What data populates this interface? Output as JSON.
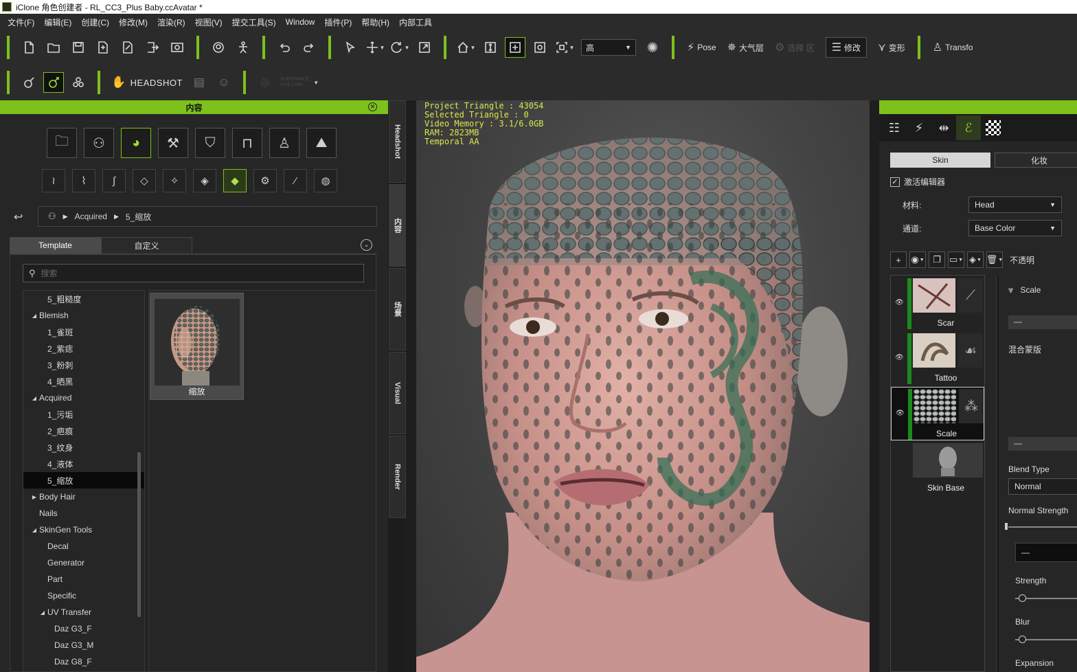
{
  "window": {
    "title": "iClone 角色创建者 - RL_CC3_Plus Baby.ccAvatar *"
  },
  "menu": [
    "文件(F)",
    "编辑(E)",
    "创建(C)",
    "修改(M)",
    "渲染(R)",
    "视图(V)",
    "提交工具(S)",
    "Window",
    "插件(P)",
    "帮助(H)",
    "内部工具"
  ],
  "toolbar": {
    "quality_value": "高",
    "pose_label": "Pose",
    "atmosphere_label": "大气层",
    "inactive_label": "选择 区",
    "modify_label": "修改",
    "deform_label": "变形",
    "transform_label": "Transfo"
  },
  "toolbar2": {
    "headshot_label": "HEADSHOT",
    "disabled_label_1": "SUBSTANCE",
    "disabled_label_2": "LIVE LINK"
  },
  "left_panel": {
    "title": "内容",
    "breadcrumb": [
      "Acquired",
      "5_缩放"
    ],
    "tabs": [
      "Template",
      "自定义"
    ],
    "search_placeholder": "搜索",
    "tree": [
      {
        "label": "5_粗糙度",
        "indent": 2,
        "arrow": ""
      },
      {
        "label": "Blemish",
        "indent": 1,
        "arrow": "down"
      },
      {
        "label": "1_雀斑",
        "indent": 2,
        "arrow": ""
      },
      {
        "label": "2_紫痣",
        "indent": 2,
        "arrow": ""
      },
      {
        "label": "3_粉刺",
        "indent": 2,
        "arrow": ""
      },
      {
        "label": "4_晒黑",
        "indent": 2,
        "arrow": ""
      },
      {
        "label": "Acquired",
        "indent": 1,
        "arrow": "down"
      },
      {
        "label": "1_污垢",
        "indent": 2,
        "arrow": ""
      },
      {
        "label": "2_疤痕",
        "indent": 2,
        "arrow": ""
      },
      {
        "label": "3_纹身",
        "indent": 2,
        "arrow": ""
      },
      {
        "label": "4_液体",
        "indent": 2,
        "arrow": ""
      },
      {
        "label": "5_缩放",
        "indent": 2,
        "arrow": "",
        "selected": true
      },
      {
        "label": "Body Hair",
        "indent": 1,
        "arrow": "right"
      },
      {
        "label": "Nails",
        "indent": 1,
        "arrow": ""
      },
      {
        "label": "SkinGen Tools",
        "indent": 1,
        "arrow": "down"
      },
      {
        "label": "Decal",
        "indent": 2,
        "arrow": ""
      },
      {
        "label": "Generator",
        "indent": 2,
        "arrow": ""
      },
      {
        "label": "Part",
        "indent": 2,
        "arrow": ""
      },
      {
        "label": "Specific",
        "indent": 2,
        "arrow": ""
      },
      {
        "label": "UV Transfer",
        "indent": 2,
        "arrow": "down"
      },
      {
        "label": "Daz G3_F",
        "indent": 3,
        "arrow": ""
      },
      {
        "label": "Daz G3_M",
        "indent": 3,
        "arrow": ""
      },
      {
        "label": "Daz G8_F",
        "indent": 3,
        "arrow": ""
      }
    ],
    "item": {
      "label": "缩放"
    }
  },
  "side_tabs": [
    "Headshot",
    "内容",
    "场景",
    "Visual",
    "Render"
  ],
  "viewport": {
    "stats": [
      "Project Triangle : 43054",
      "Selected Triangle : 0",
      "Video Memory : 3.1/6.0GB",
      "RAM: 2823MB",
      "Temporal AA"
    ]
  },
  "right_panel": {
    "segments": [
      "Skin",
      "化妆"
    ],
    "activate_label": "激活编辑器",
    "activate_checked": true,
    "material_label": "材料:",
    "material_value": "Head",
    "channel_label": "通道:",
    "channel_value": "Base Color",
    "opacity_label": "不透明",
    "layers": [
      {
        "name": "Scar",
        "selected": false
      },
      {
        "name": "Tattoo",
        "selected": false
      },
      {
        "name": "Scale",
        "selected": true
      },
      {
        "name": "Skin Base",
        "selected": false
      }
    ],
    "props": {
      "title": "Scale",
      "minus_1": "—",
      "mask_label": "混合蒙版",
      "minus_2": "—",
      "blend_type_label": "Blend Type",
      "blend_type_value": "Normal",
      "normal_strength_label": "Normal Strength",
      "minus_3": "—",
      "strength_label": "Strength",
      "blur_label": "Blur",
      "expansion_label": "Expansion"
    }
  },
  "colors": {
    "accent": "#7ec11c",
    "stats_text": "#d8e84a",
    "panel_bg": "#262626"
  }
}
